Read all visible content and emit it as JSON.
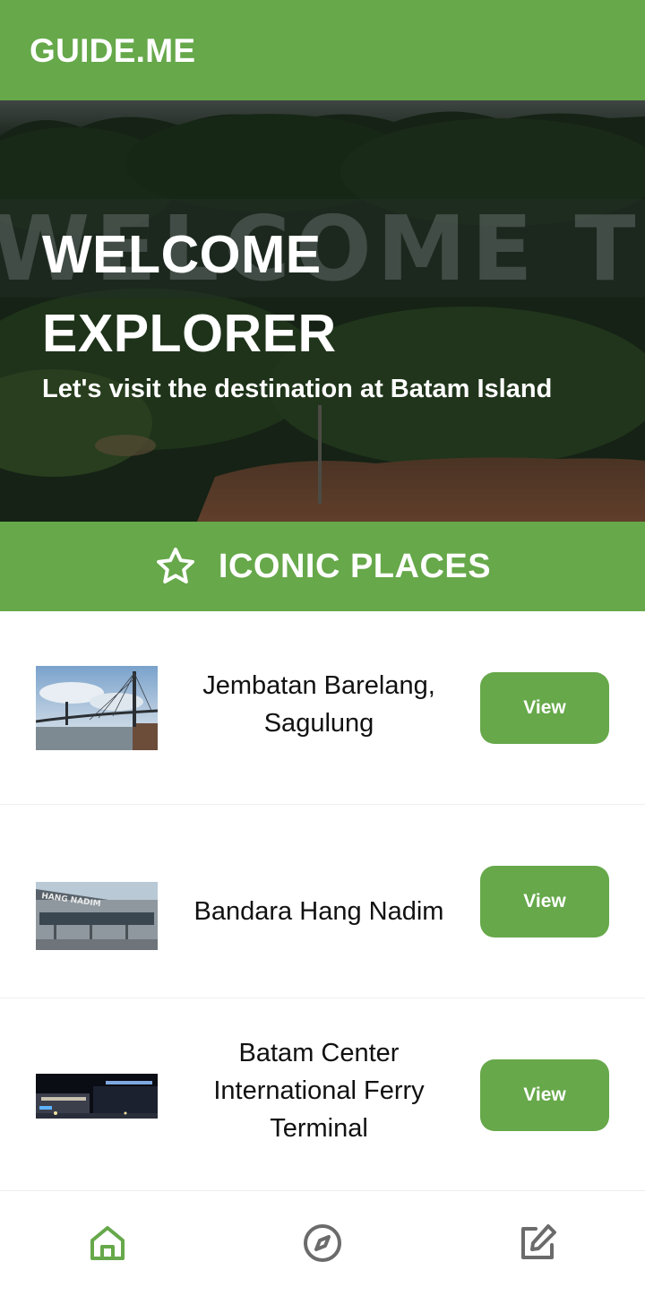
{
  "app": {
    "title": "GUIDE.ME"
  },
  "hero": {
    "title_line1": "WELCOME",
    "title_line2": "EXPLORER",
    "subtitle": "Let's visit the destination at Batam Island",
    "background_sign_text": "WELCOME TO BATAM"
  },
  "section": {
    "title": "ICONIC PLACES",
    "icon": "star-outline-icon"
  },
  "places": [
    {
      "name": "Jembatan Barelang, Sagulung",
      "button_label": "View",
      "thumbnail": "bridge-photo"
    },
    {
      "name": "Bandara Hang Nadim",
      "button_label": "View",
      "thumbnail": "airport-photo"
    },
    {
      "name": "Batam Center International Ferry Terminal",
      "button_label": "View",
      "thumbnail": "ferry-terminal-night-photo"
    }
  ],
  "bottom_nav": {
    "items": [
      {
        "icon": "home-icon",
        "active": true
      },
      {
        "icon": "compass-icon",
        "active": false
      },
      {
        "icon": "edit-icon",
        "active": false
      }
    ]
  },
  "colors": {
    "primary": "#66a84a",
    "text": "#111111",
    "inactive_icon": "#6b6b6b"
  }
}
